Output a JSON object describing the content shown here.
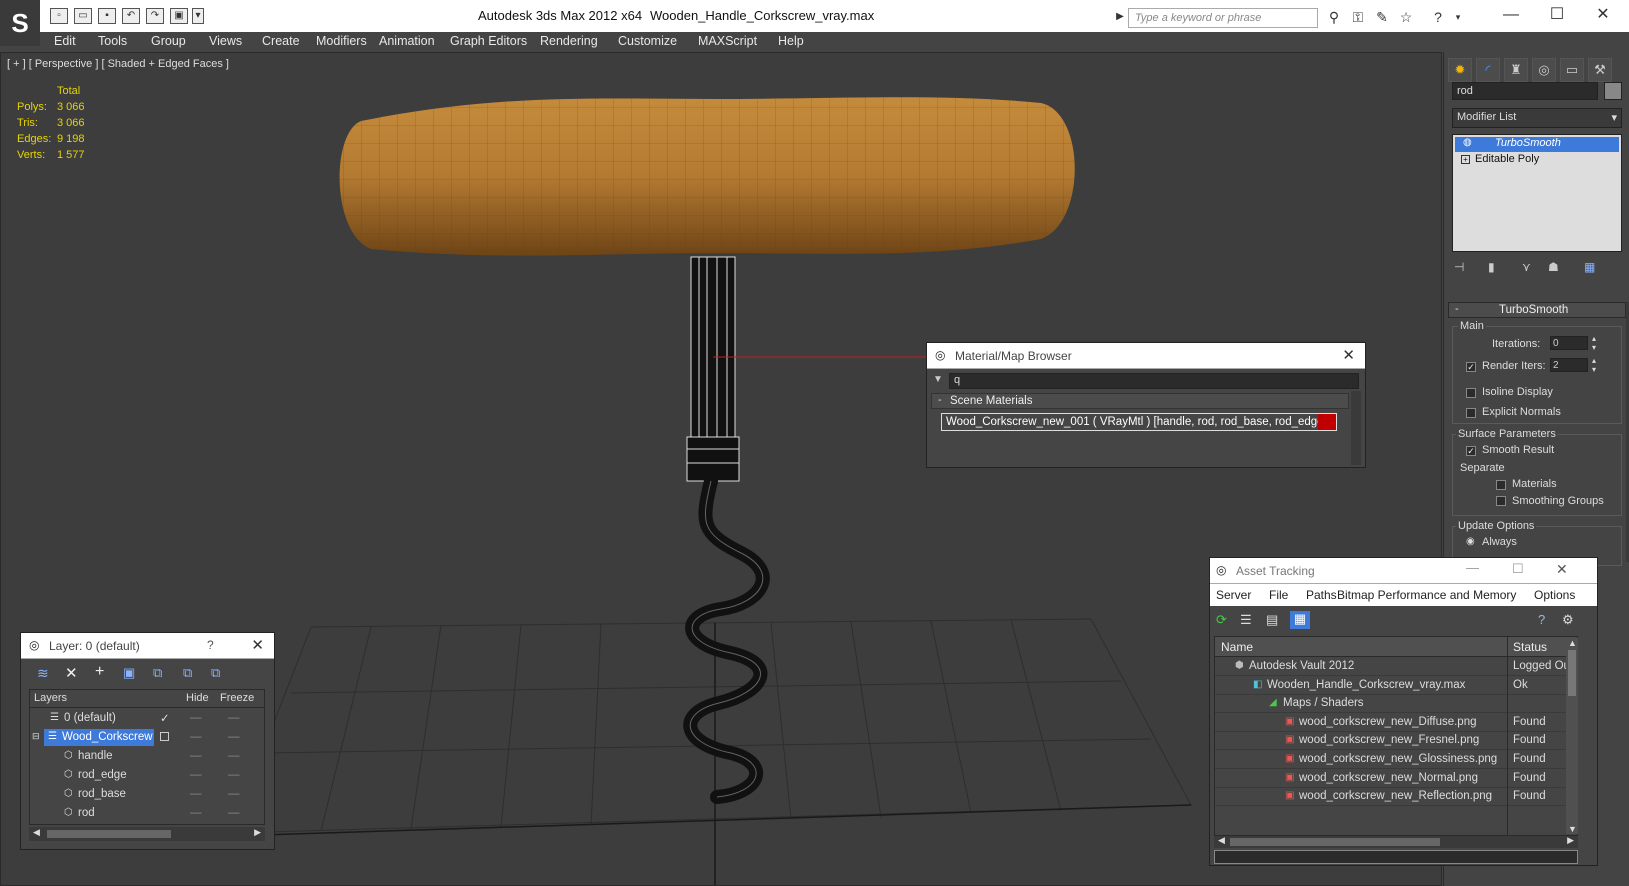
{
  "titlebar": {
    "app_title": "Autodesk 3ds Max  2012 x64",
    "file_name": "Wooden_Handle_Corkscrew_vray.max",
    "search_placeholder": "Type a keyword or phrase",
    "logo": "3ds-max-logo"
  },
  "menu": [
    "Edit",
    "Tools",
    "Group",
    "Views",
    "Create",
    "Modifiers",
    "Animation",
    "Graph Editors",
    "Rendering",
    "Customize",
    "MAXScript",
    "Help"
  ],
  "viewport": {
    "label": "[ + ] [ Perspective ] [ Shaded + Edged Faces ]",
    "stats_header": "Total",
    "stats": [
      {
        "label": "Polys:",
        "value": "3 066"
      },
      {
        "label": "Tris:",
        "value": "3 066"
      },
      {
        "label": "Edges:",
        "value": "9 198"
      },
      {
        "label": "Verts:",
        "value": "1 577"
      }
    ]
  },
  "command_panel": {
    "name_field": "rod",
    "modifier_list_label": "Modifier List",
    "stack": [
      {
        "label": "TurboSmooth",
        "selected": true
      },
      {
        "label": "Editable Poly",
        "selected": false
      }
    ],
    "rollout_title": "TurboSmooth",
    "main_group": "Main",
    "iterations_label": "Iterations:",
    "iterations_value": "0",
    "render_iters_label": "Render Iters:",
    "render_iters_value": "2",
    "render_iters_checked": true,
    "isoline_label": "Isoline Display",
    "explicit_normals_label": "Explicit Normals",
    "surface_params": "Surface Parameters",
    "smooth_result": "Smooth Result",
    "separate": "Separate",
    "materials": "Materials",
    "smoothing_groups": "Smoothing Groups",
    "update_options": "Update Options",
    "always": "Always"
  },
  "material_browser": {
    "title": "Material/Map Browser",
    "search_value": "q",
    "section": "Scene Materials",
    "item": "Wood_Corkscrew_new_001  ( VRayMtl )  [handle, rod, rod_base, rod_edge]",
    "item_swatch": "#c00000"
  },
  "layer_dialog": {
    "title": "Layer: 0 (default)",
    "columns": [
      "Layers",
      "Hide",
      "Freeze"
    ],
    "rows": [
      {
        "name": "0 (default)",
        "indent": 1,
        "selected": false
      },
      {
        "name": "Wood_Corkscrew",
        "indent": 0,
        "selected": true
      },
      {
        "name": "handle",
        "indent": 2,
        "selected": false
      },
      {
        "name": "rod_edge",
        "indent": 2,
        "selected": false
      },
      {
        "name": "rod_base",
        "indent": 2,
        "selected": false
      },
      {
        "name": "rod",
        "indent": 2,
        "selected": false
      }
    ]
  },
  "asset_tracking": {
    "title": "Asset Tracking",
    "menu": [
      "Server",
      "File",
      "Paths",
      "Bitmap Performance and Memory",
      "Options"
    ],
    "columns": [
      "Name",
      "Status"
    ],
    "rows": [
      {
        "name": "Autodesk Vault 2012",
        "status": "Logged Ou",
        "indent": 1
      },
      {
        "name": "Wooden_Handle_Corkscrew_vray.max",
        "status": "Ok",
        "indent": 2
      },
      {
        "name": "Maps / Shaders",
        "status": "",
        "indent": 3
      },
      {
        "name": "wood_corkscrew_new_Diffuse.png",
        "status": "Found",
        "indent": 4
      },
      {
        "name": "wood_corkscrew_new_Fresnel.png",
        "status": "Found",
        "indent": 4
      },
      {
        "name": "wood_corkscrew_new_Glossiness.png",
        "status": "Found",
        "indent": 4
      },
      {
        "name": "wood_corkscrew_new_Normal.png",
        "status": "Found",
        "indent": 4
      },
      {
        "name": "wood_corkscrew_new_Reflection.png",
        "status": "Found",
        "indent": 4
      }
    ]
  },
  "colors": {
    "wood": "#b37a32",
    "selection": "#3d7ad9",
    "stats": "#e5d400"
  }
}
